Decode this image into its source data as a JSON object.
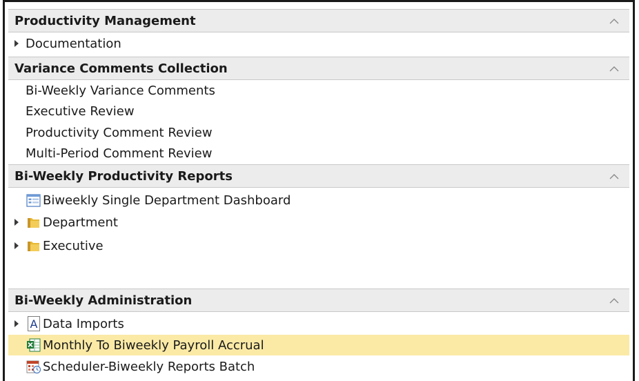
{
  "sections": [
    {
      "title": "Productivity Management",
      "items": [
        {
          "label": "Documentation",
          "expandable": true,
          "icon": "none"
        }
      ]
    },
    {
      "title": "Variance Comments Collection",
      "items": [
        {
          "label": "Bi-Weekly Variance Comments",
          "icon": "none"
        },
        {
          "label": "Executive Review",
          "icon": "none"
        },
        {
          "label": "Productivity Comment Review",
          "icon": "none"
        },
        {
          "label": "Multi-Period Comment Review",
          "icon": "none"
        }
      ]
    },
    {
      "title": "Bi-Weekly Productivity Reports",
      "items": [
        {
          "label": "Biweekly Single Department Dashboard",
          "icon": "dashboard-icon"
        },
        {
          "label": "Department",
          "expandable": true,
          "icon": "folder-icon"
        },
        {
          "label": "Executive",
          "expandable": true,
          "icon": "folder-icon"
        }
      ]
    },
    {
      "title": "Bi-Weekly Administration",
      "items": [
        {
          "label": "Data Imports",
          "expandable": true,
          "icon": "text-a-icon",
          "icon_glyph": "A"
        },
        {
          "label": "Monthly To Biweekly Payroll Accrual",
          "icon": "spreadsheet-icon",
          "selected": true
        },
        {
          "label": "Scheduler-Biweekly Reports Batch",
          "icon": "scheduler-icon"
        }
      ]
    }
  ],
  "colors": {
    "header_bg": "#ececec",
    "selected_bg": "#fbeaa6",
    "folder": "#e8b934",
    "spreadsheet": "#1f7a3a",
    "dashboard": "#4a7ac0",
    "scheduler": "#c0452a"
  }
}
